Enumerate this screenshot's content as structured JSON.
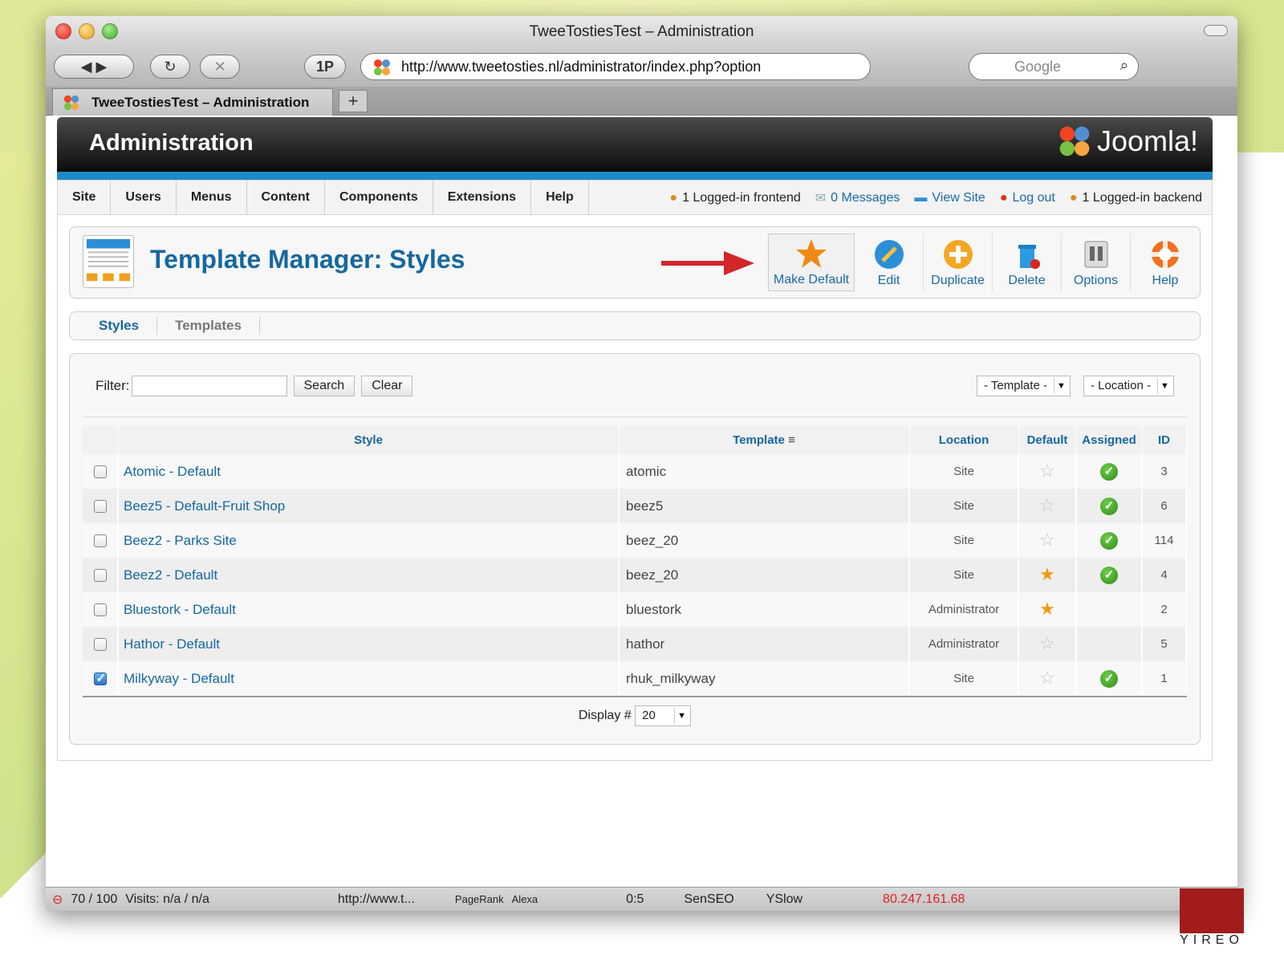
{
  "window": {
    "title": "TweeTostiesTest – Administration"
  },
  "browser": {
    "address": "http://www.tweetosties.nl/administrator/index.php?option",
    "search_placeholder": "Google",
    "tab_label": "TweeTostiesTest – Administration",
    "new_tab": "+",
    "onepw_label": "1P"
  },
  "admin": {
    "header_title": "Administration",
    "logo_text": "Joomla!",
    "menu": [
      "Site",
      "Users",
      "Menus",
      "Content",
      "Components",
      "Extensions",
      "Help"
    ],
    "status": {
      "frontend": "1 Logged-in frontend",
      "messages": "0 Messages",
      "view_site": "View Site",
      "logout": "Log out",
      "backend": "1 Logged-in backend"
    },
    "page_title": "Template Manager: Styles",
    "toolbar": {
      "make_default": "Make Default",
      "edit": "Edit",
      "duplicate": "Duplicate",
      "delete": "Delete",
      "options": "Options",
      "help": "Help"
    },
    "subtabs": [
      "Styles",
      "Templates"
    ],
    "filter": {
      "label": "Filter:",
      "value": "",
      "search": "Search",
      "clear": "Clear",
      "template_select": "- Template -",
      "location_select": "- Location -"
    },
    "table": {
      "headers": [
        "Style",
        "Template",
        "Location",
        "Default",
        "Assigned",
        "ID"
      ],
      "rows": [
        {
          "style": "Atomic - Default",
          "template": "atomic",
          "location": "Site",
          "default": false,
          "assigned": true,
          "id": "3",
          "checked": false
        },
        {
          "style": "Beez5 - Default-Fruit Shop",
          "template": "beez5",
          "location": "Site",
          "default": false,
          "assigned": true,
          "id": "6",
          "checked": false
        },
        {
          "style": "Beez2 - Parks Site",
          "template": "beez_20",
          "location": "Site",
          "default": false,
          "assigned": true,
          "id": "114",
          "checked": false
        },
        {
          "style": "Beez2 - Default",
          "template": "beez_20",
          "location": "Site",
          "default": true,
          "assigned": true,
          "id": "4",
          "checked": false
        },
        {
          "style": "Bluestork - Default",
          "template": "bluestork",
          "location": "Administrator",
          "default": true,
          "assigned": false,
          "id": "2",
          "checked": false
        },
        {
          "style": "Hathor - Default",
          "template": "hathor",
          "location": "Administrator",
          "default": false,
          "assigned": false,
          "id": "5",
          "checked": false
        },
        {
          "style": "Milkyway - Default",
          "template": "rhuk_milkyway",
          "location": "Site",
          "default": false,
          "assigned": true,
          "id": "1",
          "checked": true
        }
      ]
    },
    "display": {
      "label": "Display #",
      "value": "20"
    }
  },
  "statusbar": {
    "rank": "70 / 100",
    "visits": "Visits: n/a / n/a",
    "url": "http://www.t...",
    "pagerank": "PageRank",
    "alexa": "Alexa",
    "ratio": "0:5",
    "senseo": "SenSEO",
    "yslow": "YSlow",
    "ip": "80.247.161.68"
  },
  "watermark": "YIREO",
  "colors": {
    "joomla_blue": "#15689e",
    "accent_bar": "#1f8ac9",
    "star": "#f09a14",
    "ok_green": "#2c8a14"
  }
}
